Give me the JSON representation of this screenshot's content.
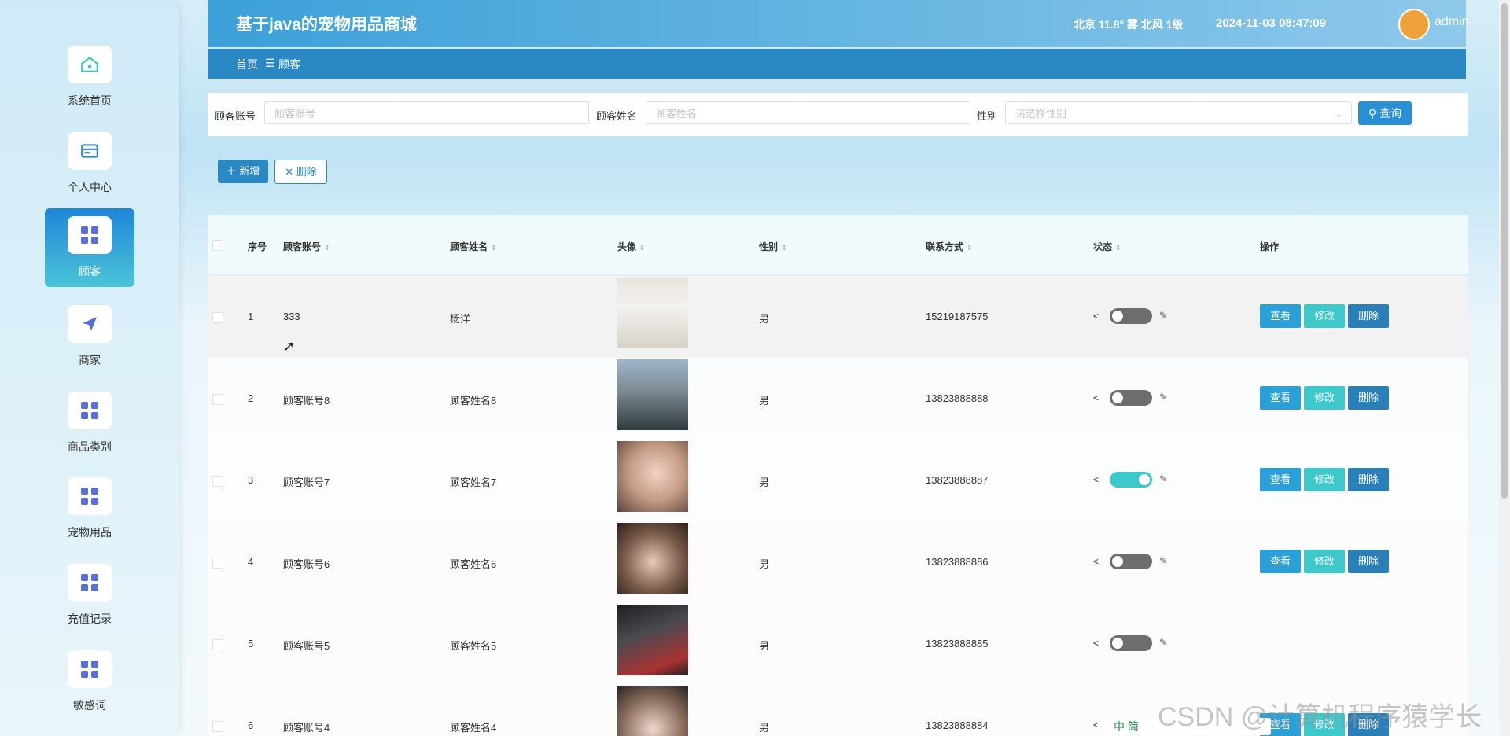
{
  "sidebar": {
    "items": [
      {
        "label": "系统首页",
        "icon": "home-icon"
      },
      {
        "label": "个人中心",
        "icon": "card-icon"
      },
      {
        "label": "顾客",
        "icon": "grid-icon",
        "active": true
      },
      {
        "label": "商家",
        "icon": "paper-plane-icon"
      },
      {
        "label": "商品类别",
        "icon": "grid-icon"
      },
      {
        "label": "宠物用品",
        "icon": "grid-icon"
      },
      {
        "label": "充值记录",
        "icon": "grid-icon"
      },
      {
        "label": "敏感词",
        "icon": "grid-icon"
      }
    ]
  },
  "header": {
    "title": "基于java的宠物用品商城",
    "weather": "北京 11.8° 雾 北风 1级",
    "datetime": "2024-11-03 08:47:09",
    "username": "admin"
  },
  "breadcrumb": {
    "home": "首页",
    "sep": "☰",
    "current": "顾客"
  },
  "search": {
    "account_label": "顾客账号",
    "account_placeholder": "顾客账号",
    "name_label": "顾客姓名",
    "name_placeholder": "顾客姓名",
    "gender_label": "性别",
    "gender_placeholder": "请选择性别",
    "query_label": "查询"
  },
  "actions": {
    "add_label": "新增",
    "delete_label": "删除"
  },
  "table": {
    "headers": [
      "序号",
      "顾客账号",
      "顾客姓名",
      "头像",
      "性别",
      "联系方式",
      "状态",
      "操作"
    ],
    "rows": [
      {
        "idx": "1",
        "account": "333",
        "name": "杨洋",
        "gender": "男",
        "phone": "15219187575",
        "status_on": false
      },
      {
        "idx": "2",
        "account": "顾客账号8",
        "name": "顾客姓名8",
        "gender": "男",
        "phone": "13823888888",
        "status_on": false
      },
      {
        "idx": "3",
        "account": "顾客账号7",
        "name": "顾客姓名7",
        "gender": "男",
        "phone": "13823888887",
        "status_on": true
      },
      {
        "idx": "4",
        "account": "顾客账号6",
        "name": "顾客姓名6",
        "gender": "男",
        "phone": "13823888886",
        "status_on": false
      },
      {
        "idx": "5",
        "account": "顾客账号5",
        "name": "顾客姓名5",
        "gender": "男",
        "phone": "13823888885",
        "status_on": false
      },
      {
        "idx": "6",
        "account": "顾客账号4",
        "name": "顾客姓名4",
        "gender": "男",
        "phone": "13823888884",
        "status_on": false
      }
    ],
    "row_actions": {
      "view": "查看",
      "edit": "修改",
      "delete": "删除"
    }
  },
  "watermark": "CSDN @计算机程序猿学长",
  "ime_bar": "中 简"
}
